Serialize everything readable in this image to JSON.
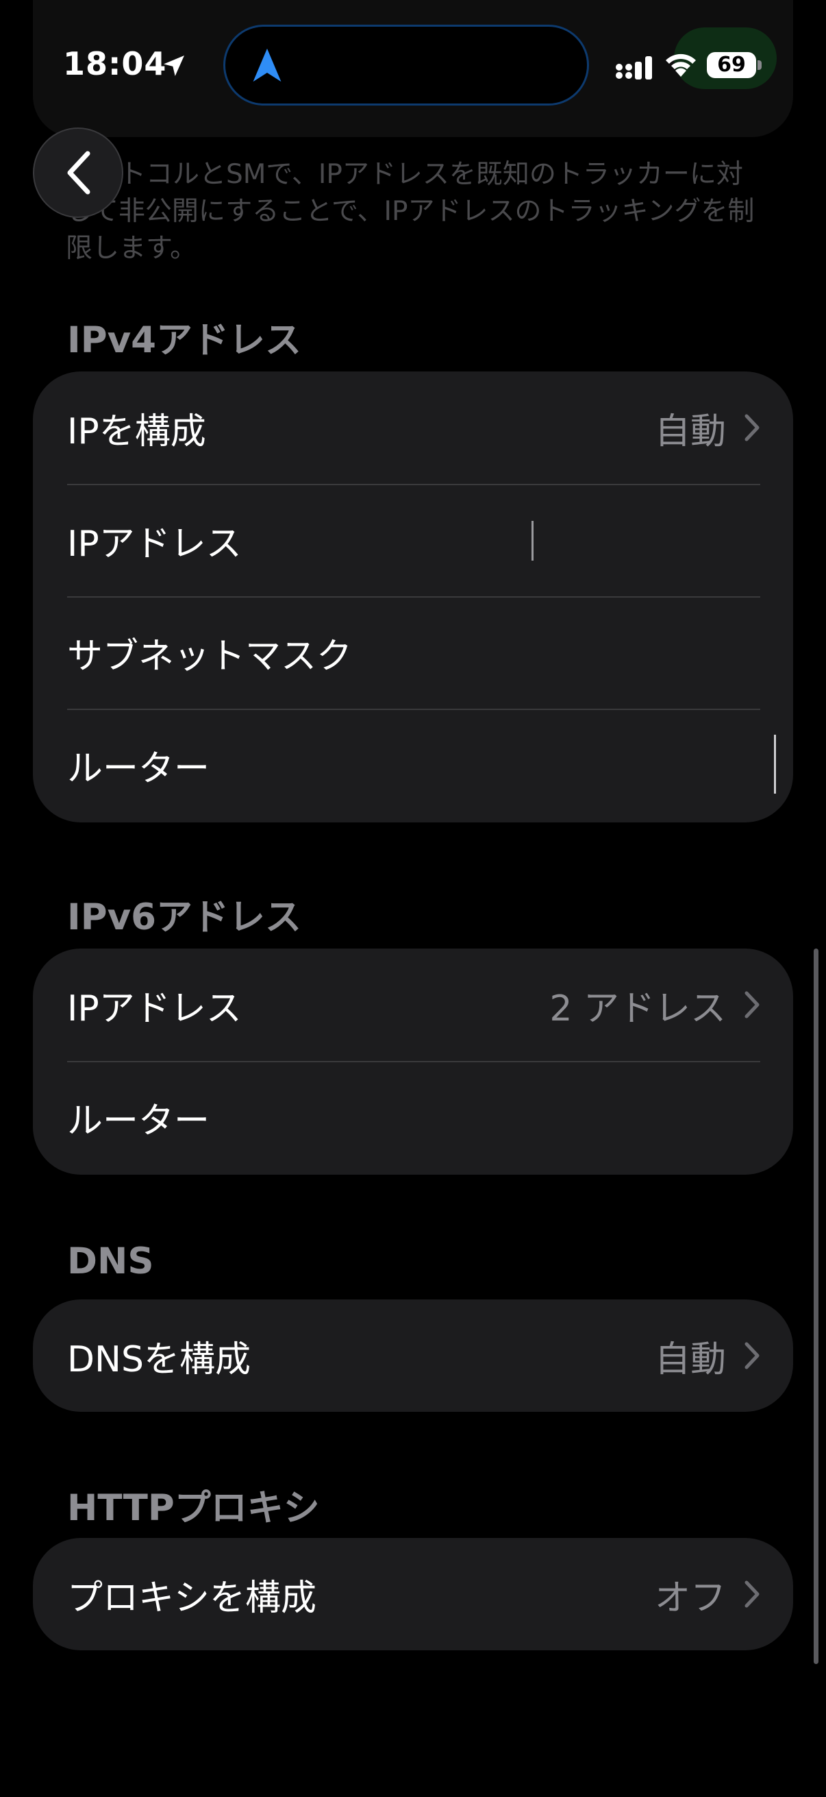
{
  "status_bar": {
    "time": "18:04",
    "battery": "69"
  },
  "faded": {
    "description": "プロトコルとSMで、IPアドレスを既知のトラッカーに対して非公開にすることで、IPアドレスのトラッキングを制限します。"
  },
  "ipv4": {
    "header": "IPv4アドレス",
    "rows": [
      {
        "label": "IPを構成",
        "value": "自動"
      },
      {
        "label": "IPアドレス",
        "value": ""
      },
      {
        "label": "サブネットマスク",
        "value": ""
      },
      {
        "label": "ルーター",
        "value": ""
      }
    ]
  },
  "ipv6": {
    "header": "IPv6アドレス",
    "rows": [
      {
        "label": "IPアドレス",
        "value": "2 アドレス"
      },
      {
        "label": "ルーター",
        "value": ""
      }
    ]
  },
  "dns": {
    "header": "DNS",
    "rows": [
      {
        "label": "DNSを構成",
        "value": "自動"
      }
    ]
  },
  "proxy": {
    "header": "HTTPプロキシ",
    "rows": [
      {
        "label": "プロキシを構成",
        "value": "オフ"
      }
    ]
  },
  "colors": {
    "background": "#000000",
    "group_background": "#1c1c1e",
    "secondary_text": "#8d8d92",
    "separator": "#3a3a3c",
    "location_blue": "#2f8df6"
  },
  "icons": [
    "location-arrow-icon",
    "navigation-arrow-icon",
    "cellular-signal-icon",
    "wifi-icon",
    "battery-icon",
    "back-chevron-icon",
    "chevron-right-icon"
  ]
}
